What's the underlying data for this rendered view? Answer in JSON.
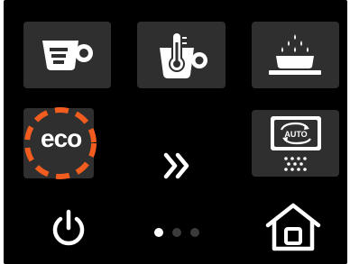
{
  "screen": {
    "background": "#000000",
    "tile_color": "#2f2f2f",
    "icon_color": "#ffffff",
    "highlight_color": "#f25c1f"
  },
  "tiles": {
    "row1": [
      {
        "icon": "espresso-cup-icon"
      },
      {
        "icon": "cup-thermometer-icon"
      },
      {
        "icon": "steam-drip-tray-icon"
      }
    ],
    "row2": [
      {
        "icon": "eco-mode-icon",
        "label": "eco",
        "highlighted": true
      },
      {
        "icon": "auto-rinse-icon",
        "label": "AUTO"
      }
    ]
  },
  "navigation": {
    "next_icon": "double-chevron-right-icon",
    "power_icon": "power-icon",
    "home_icon": "home-icon",
    "page_count": 3,
    "current_page": 1
  }
}
